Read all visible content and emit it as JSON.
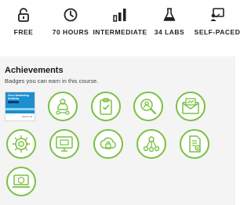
{
  "features": [
    {
      "label": "FREE",
      "icon": "lock-open-icon"
    },
    {
      "label": "70 HOURS",
      "icon": "clock-icon"
    },
    {
      "label": "INTERMEDIATE",
      "icon": "signal-bars-icon"
    },
    {
      "label": "34 LABS",
      "icon": "flask-icon"
    },
    {
      "label": "SELF-PACED",
      "icon": "presenter-icon"
    }
  ],
  "achievements": {
    "title": "Achievements",
    "subtitle": "Badges you can earn in this course.",
    "certificate": {
      "title": "Cisco Networking Academy",
      "footer": "Skills for All"
    },
    "accent": "#7ac143",
    "badges": [
      {
        "icon": "people-network-icon"
      },
      {
        "icon": "clipboard-check-icon"
      },
      {
        "icon": "magnifier-person-icon"
      },
      {
        "icon": "envelope-chart-icon"
      },
      {
        "icon": "target-gear-icon"
      },
      {
        "icon": "monitor-icon"
      },
      {
        "icon": "cloud-lock-icon"
      },
      {
        "icon": "network-nodes-icon"
      },
      {
        "icon": "document-check-icon"
      },
      {
        "icon": "laptop-shield-icon"
      }
    ]
  }
}
